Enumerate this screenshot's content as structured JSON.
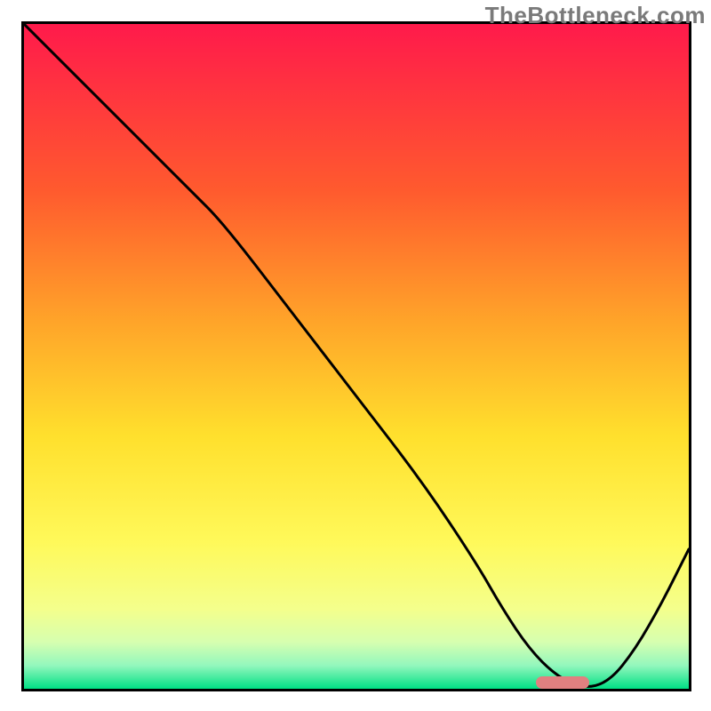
{
  "watermark": "TheBottleneck.com",
  "chart_data": {
    "type": "line",
    "title": "",
    "xlabel": "",
    "ylabel": "",
    "xlim": [
      0,
      100
    ],
    "ylim": [
      0,
      100
    ],
    "grid": false,
    "legend": false,
    "background": {
      "type": "vertical-gradient",
      "stops": [
        {
          "pos": 0.0,
          "color": "#ff1a4b"
        },
        {
          "pos": 0.25,
          "color": "#ff5a2e"
        },
        {
          "pos": 0.45,
          "color": "#ffa529"
        },
        {
          "pos": 0.62,
          "color": "#ffe02d"
        },
        {
          "pos": 0.78,
          "color": "#fff95a"
        },
        {
          "pos": 0.88,
          "color": "#f4ff8c"
        },
        {
          "pos": 0.93,
          "color": "#d6ffb0"
        },
        {
          "pos": 0.965,
          "color": "#93f7bd"
        },
        {
          "pos": 1.0,
          "color": "#00e084"
        }
      ]
    },
    "series": [
      {
        "name": "bottleneck-curve",
        "color": "#000000",
        "stroke_width": 3,
        "x": [
          0,
          10,
          20,
          25,
          30,
          40,
          50,
          60,
          68,
          72,
          76,
          80,
          84,
          88,
          92,
          96,
          100
        ],
        "y": [
          100,
          90,
          80,
          75,
          70,
          57,
          44,
          31,
          19,
          12,
          6,
          2,
          0,
          1,
          6,
          13,
          21
        ]
      }
    ],
    "annotations": [
      {
        "name": "optimal-marker",
        "type": "pill",
        "x_start": 77,
        "x_end": 85,
        "y": 1,
        "color": "#e08080"
      }
    ]
  }
}
